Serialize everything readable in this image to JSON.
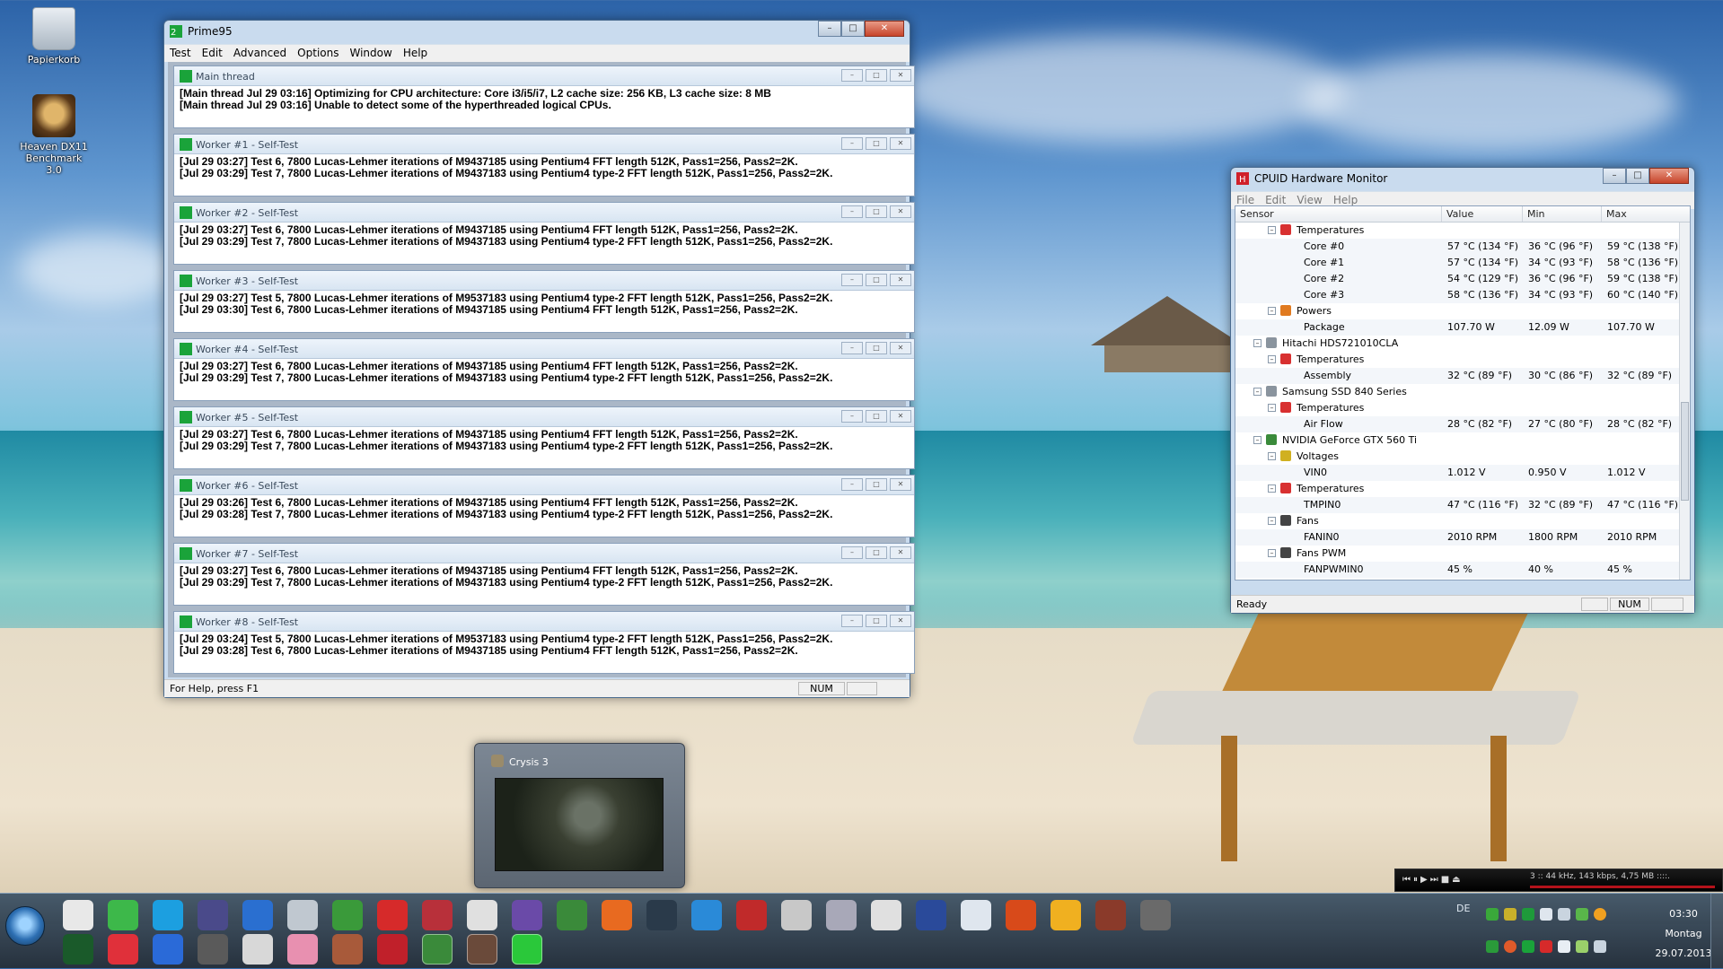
{
  "desktop": {
    "icons": [
      {
        "label": "Papierkorb",
        "icon": "recycle-bin-icon"
      },
      {
        "label": "Heaven DX11 Benchmark 3.0",
        "icon": "heaven-benchmark-icon"
      }
    ]
  },
  "prime95": {
    "title": "Prime95",
    "menu": [
      "Test",
      "Edit",
      "Advanced",
      "Options",
      "Window",
      "Help"
    ],
    "children": [
      {
        "title": "Main thread",
        "lines": [
          "[Main thread Jul 29 03:16] Optimizing for CPU architecture: Core i3/i5/i7, L2 cache size: 256 KB, L3 cache size: 8 MB",
          "[Main thread Jul 29 03:16] Unable to detect some of the hyperthreaded logical CPUs."
        ]
      },
      {
        "title": "Worker #1 - Self-Test",
        "lines": [
          "[Jul 29 03:27] Test 6, 7800 Lucas-Lehmer iterations of M9437185 using Pentium4 FFT length 512K, Pass1=256, Pass2=2K.",
          "[Jul 29 03:29] Test 7, 7800 Lucas-Lehmer iterations of M9437183 using Pentium4 type-2 FFT length 512K, Pass1=256, Pass2=2K."
        ]
      },
      {
        "title": "Worker #2 - Self-Test",
        "lines": [
          "[Jul 29 03:27] Test 6, 7800 Lucas-Lehmer iterations of M9437185 using Pentium4 FFT length 512K, Pass1=256, Pass2=2K.",
          "[Jul 29 03:29] Test 7, 7800 Lucas-Lehmer iterations of M9437183 using Pentium4 type-2 FFT length 512K, Pass1=256, Pass2=2K."
        ]
      },
      {
        "title": "Worker #3 - Self-Test",
        "lines": [
          "[Jul 29 03:27] Test 5, 7800 Lucas-Lehmer iterations of M9537183 using Pentium4 type-2 FFT length 512K, Pass1=256, Pass2=2K.",
          "[Jul 29 03:30] Test 6, 7800 Lucas-Lehmer iterations of M9437185 using Pentium4 FFT length 512K, Pass1=256, Pass2=2K."
        ]
      },
      {
        "title": "Worker #4 - Self-Test",
        "lines": [
          "[Jul 29 03:27] Test 6, 7800 Lucas-Lehmer iterations of M9437185 using Pentium4 FFT length 512K, Pass1=256, Pass2=2K.",
          "[Jul 29 03:29] Test 7, 7800 Lucas-Lehmer iterations of M9437183 using Pentium4 type-2 FFT length 512K, Pass1=256, Pass2=2K."
        ]
      },
      {
        "title": "Worker #5 - Self-Test",
        "lines": [
          "[Jul 29 03:27] Test 6, 7800 Lucas-Lehmer iterations of M9437185 using Pentium4 FFT length 512K, Pass1=256, Pass2=2K.",
          "[Jul 29 03:29] Test 7, 7800 Lucas-Lehmer iterations of M9437183 using Pentium4 type-2 FFT length 512K, Pass1=256, Pass2=2K."
        ]
      },
      {
        "title": "Worker #6 - Self-Test",
        "lines": [
          "[Jul 29 03:26] Test 6, 7800 Lucas-Lehmer iterations of M9437185 using Pentium4 FFT length 512K, Pass1=256, Pass2=2K.",
          "[Jul 29 03:28] Test 7, 7800 Lucas-Lehmer iterations of M9437183 using Pentium4 type-2 FFT length 512K, Pass1=256, Pass2=2K."
        ]
      },
      {
        "title": "Worker #7 - Self-Test",
        "lines": [
          "[Jul 29 03:27] Test 6, 7800 Lucas-Lehmer iterations of M9437185 using Pentium4 FFT length 512K, Pass1=256, Pass2=2K.",
          "[Jul 29 03:29] Test 7, 7800 Lucas-Lehmer iterations of M9437183 using Pentium4 type-2 FFT length 512K, Pass1=256, Pass2=2K."
        ]
      },
      {
        "title": "Worker #8 - Self-Test",
        "lines": [
          "[Jul 29 03:24] Test 5, 7800 Lucas-Lehmer iterations of M9537183 using Pentium4 type-2 FFT length 512K, Pass1=256, Pass2=2K.",
          "[Jul 29 03:28] Test 6, 7800 Lucas-Lehmer iterations of M9437185 using Pentium4 FFT length 512K, Pass1=256, Pass2=2K."
        ]
      }
    ],
    "status": "For Help, press F1",
    "num": "NUM"
  },
  "hwmon": {
    "title": "CPUID Hardware Monitor",
    "menu": [
      "File",
      "Edit",
      "View",
      "Help"
    ],
    "columns": [
      "Sensor",
      "Value",
      "Min",
      "Max"
    ],
    "rows": [
      {
        "level": 2,
        "kind": "group",
        "icon": "thermometer-icon",
        "label": "Temperatures"
      },
      {
        "level": 3,
        "kind": "value",
        "label": "Core #0",
        "value": "57 °C  (134 °F)",
        "min": "36 °C  (96 °F)",
        "max": "59 °C  (138 °F)"
      },
      {
        "level": 3,
        "kind": "value",
        "label": "Core #1",
        "value": "57 °C  (134 °F)",
        "min": "34 °C  (93 °F)",
        "max": "58 °C  (136 °F)"
      },
      {
        "level": 3,
        "kind": "value",
        "label": "Core #2",
        "value": "54 °C  (129 °F)",
        "min": "36 °C  (96 °F)",
        "max": "59 °C  (138 °F)"
      },
      {
        "level": 3,
        "kind": "value",
        "label": "Core #3",
        "value": "58 °C  (136 °F)",
        "min": "34 °C  (93 °F)",
        "max": "60 °C  (140 °F)"
      },
      {
        "level": 2,
        "kind": "group",
        "icon": "power-icon",
        "label": "Powers"
      },
      {
        "level": 3,
        "kind": "value",
        "label": "Package",
        "value": "107.70 W",
        "min": "12.09 W",
        "max": "107.70 W"
      },
      {
        "level": 1,
        "kind": "device",
        "icon": "hard-disk-icon",
        "label": "Hitachi HDS721010CLA"
      },
      {
        "level": 2,
        "kind": "group",
        "icon": "thermometer-icon",
        "label": "Temperatures"
      },
      {
        "level": 3,
        "kind": "value",
        "label": "Assembly",
        "value": "32 °C  (89 °F)",
        "min": "30 °C  (86 °F)",
        "max": "32 °C  (89 °F)"
      },
      {
        "level": 1,
        "kind": "device",
        "icon": "hard-disk-icon",
        "label": "Samsung SSD 840 Series"
      },
      {
        "level": 2,
        "kind": "group",
        "icon": "thermometer-icon",
        "label": "Temperatures"
      },
      {
        "level": 3,
        "kind": "value",
        "label": "Air Flow",
        "value": "28 °C  (82 °F)",
        "min": "27 °C  (80 °F)",
        "max": "28 °C  (82 °F)"
      },
      {
        "level": 1,
        "kind": "device",
        "icon": "graphics-card-icon",
        "label": "NVIDIA GeForce GTX 560 Ti"
      },
      {
        "level": 2,
        "kind": "group",
        "icon": "voltage-icon",
        "label": "Voltages"
      },
      {
        "level": 3,
        "kind": "value",
        "label": "VIN0",
        "value": "1.012 V",
        "min": "0.950 V",
        "max": "1.012 V"
      },
      {
        "level": 2,
        "kind": "group",
        "icon": "thermometer-icon",
        "label": "Temperatures"
      },
      {
        "level": 3,
        "kind": "value",
        "label": "TMPIN0",
        "value": "47 °C  (116 °F)",
        "min": "32 °C  (89 °F)",
        "max": "47 °C  (116 °F)"
      },
      {
        "level": 2,
        "kind": "group",
        "icon": "fan-icon",
        "label": "Fans"
      },
      {
        "level": 3,
        "kind": "value",
        "label": "FANIN0",
        "value": "2010 RPM",
        "min": "1800 RPM",
        "max": "2010 RPM"
      },
      {
        "level": 2,
        "kind": "group",
        "icon": "fan-icon",
        "label": "Fans PWM"
      },
      {
        "level": 3,
        "kind": "value",
        "label": "FANPWMIN0",
        "value": "45 %",
        "min": "40 %",
        "max": "45 %"
      }
    ],
    "status": "Ready",
    "num": "NUM"
  },
  "crysis_preview": {
    "title": "Crysis 3"
  },
  "media_player": {
    "info": "3 :: 44 kHz, 143 kbps, 4,75 MB ::::."
  },
  "taskbar": {
    "row1": [
      "chrome-icon",
      "icq-icon",
      "skype-icon",
      "fs-icon",
      "lightning-icon",
      "monitor-icon",
      "xbox-icon",
      "flash-icon",
      "live-icon",
      "clapper-icon",
      "photo-icon",
      "globe-icon",
      "origin-icon",
      "steam-icon",
      "uplay-icon",
      "headset-icon",
      "cross-icon",
      "fighter-icon",
      "gta-iv-icon",
      "runner-icon",
      "counter-strike-icon",
      "half-life-2-icon",
      "max-payne-icon",
      "cowboy-icon",
      "soldier-icon"
    ],
    "row2": [
      "prime95-icon",
      "record-icon",
      "globe-blue-icon",
      "distrib-icon",
      "nfs-icon",
      "girl-icon",
      "portrait-icon",
      "red-bar-icon",
      "globe-green-icon",
      "crysis-icon",
      "hwmon-taskbar-icon"
    ],
    "language": "DE",
    "time": "03:30",
    "day": "Montag",
    "date": "29.07.2013"
  }
}
